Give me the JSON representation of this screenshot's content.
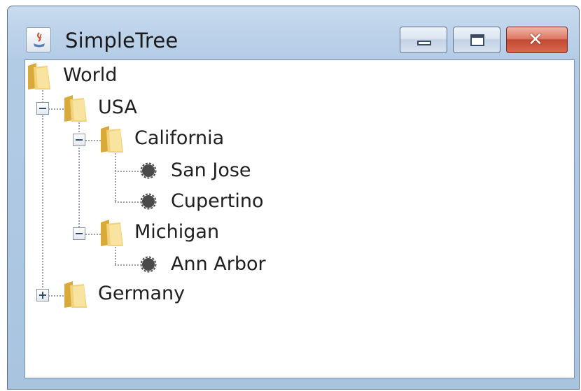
{
  "window": {
    "title": "SimpleTree",
    "controls": {
      "minimize": "minimize",
      "maximize": "maximize",
      "close": "close"
    }
  },
  "tree": {
    "root": {
      "label": "World",
      "icon": "folder-icon"
    },
    "nodes": [
      {
        "label": "USA",
        "expanded": true,
        "icon": "folder-icon"
      },
      {
        "label": "California",
        "expanded": true,
        "icon": "folder-icon"
      },
      {
        "label": "San Jose",
        "icon": "leaf-bullet-icon"
      },
      {
        "label": "Cupertino",
        "icon": "leaf-bullet-icon"
      },
      {
        "label": "Michigan",
        "expanded": true,
        "icon": "folder-icon"
      },
      {
        "label": "Ann Arbor",
        "icon": "leaf-bullet-icon"
      },
      {
        "label": "Germany",
        "expanded": false,
        "icon": "folder-icon"
      }
    ]
  },
  "colors": {
    "title_bar": "#bcd2ea",
    "close_button": "#c34a32",
    "folder": "#e9c35a",
    "leaf_bullet": "#4a4a4a"
  }
}
